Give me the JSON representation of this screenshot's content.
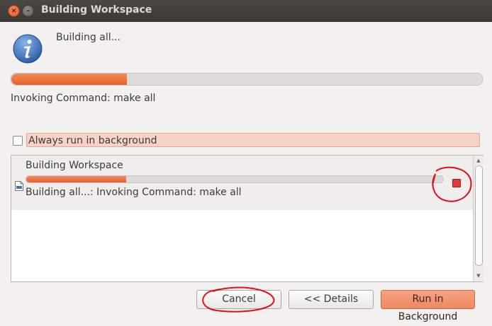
{
  "window": {
    "title": "Building Workspace",
    "close_glyph": "×",
    "minimize_glyph": "–"
  },
  "main": {
    "message": "Building all...",
    "progress_fraction": 0.245,
    "task_message": "Invoking Command: make all"
  },
  "options": {
    "always_background_label": "Always run in background",
    "always_background_checked": false
  },
  "jobs": [
    {
      "name": "Building Workspace",
      "progress_fraction": 0.24,
      "message": "Building all...: Invoking Command: make all",
      "icon": "binary-file-icon"
    }
  ],
  "buttons": {
    "cancel": "Cancel",
    "details": "<< Details",
    "run_in_background": "Run in Background"
  },
  "colors": {
    "accent": "#e2622d",
    "annotation": "#e0101a"
  }
}
